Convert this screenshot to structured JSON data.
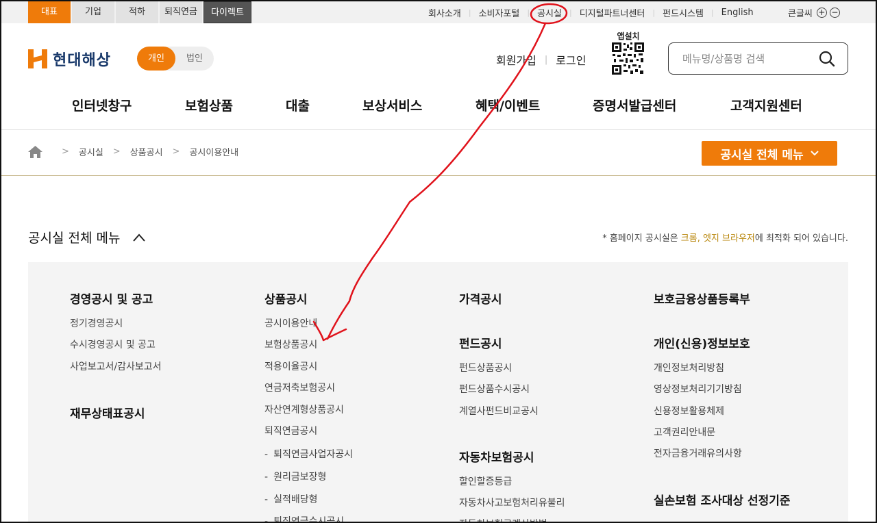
{
  "topbar": {
    "site_tabs": [
      "대표",
      "기업",
      "적하",
      "퇴직연금",
      "다이렉트"
    ],
    "util_links": [
      "회사소개",
      "소비자포털",
      "공시실",
      "디지털파트너센터",
      "펀드시스템",
      "English"
    ],
    "font_size_label": "큰글씨",
    "plus": "+",
    "minus": "−"
  },
  "header": {
    "logo_text": "현대해상",
    "toggle": [
      "개인",
      "법인"
    ],
    "signup": "회원가입",
    "login": "로그인",
    "qr_label": "앱설치",
    "search_placeholder": "메뉴명/상품명 검색"
  },
  "gnb": [
    "인터넷창구",
    "보험상품",
    "대출",
    "보상서비스",
    "혜택/이벤트",
    "증명서발급센터",
    "고객지원센터"
  ],
  "breadcrumb": [
    "공시실",
    "상품공시",
    "공시이용안내"
  ],
  "all_menu_button": "공시실 전체 메뉴",
  "panel": {
    "title": "공시실 전체 메뉴",
    "notice_pre": "* 홈페이지 공시실은 ",
    "notice_hl": "크롬, 엣지 브라우저",
    "notice_post": "에 최적화 되어 있습니다."
  },
  "menu": {
    "col1": {
      "group1_title": "경영공시 및 공고",
      "group1_items": [
        "정기경영공시",
        "수시경영공시 및 공고",
        "사업보고서/감사보고서"
      ],
      "group2_title": "재무상태표공시"
    },
    "col2": {
      "title": "상품공시",
      "items": [
        "공시이용안내",
        "보험상품공시",
        "적용이율공시",
        "연금저축보험공시",
        "자산연계형상품공시",
        "퇴직연금공시"
      ],
      "sub_items": [
        "퇴직연금사업자공시",
        "원리금보장형",
        "실적배당형",
        "퇴직연금수시공시"
      ]
    },
    "col3": {
      "group1_title": "가격공시",
      "group2_title": "펀드공시",
      "group2_items": [
        "펀드상품공시",
        "펀드상품수시공시",
        "계열사펀드비교공시"
      ],
      "group3_title": "자동차보험공시",
      "group3_items": [
        "할인할증등급",
        "자동차사고보험처리유불리",
        "자동차보험료계산방법"
      ]
    },
    "col4": {
      "group1_title": "보호금융상품등록부",
      "group2_title": "개인(신용)정보보호",
      "group2_items": [
        "개인정보처리방침",
        "영상정보처리기기방침",
        "신용정보활용체제",
        "고객권리안내문",
        "전자금융거래유의사항"
      ],
      "group3_title": "실손보험 조사대상 선정기준"
    }
  },
  "colors": {
    "accent": "#ef7b0a",
    "brand": "#1a3a6b",
    "annotation": "#e0121b"
  }
}
